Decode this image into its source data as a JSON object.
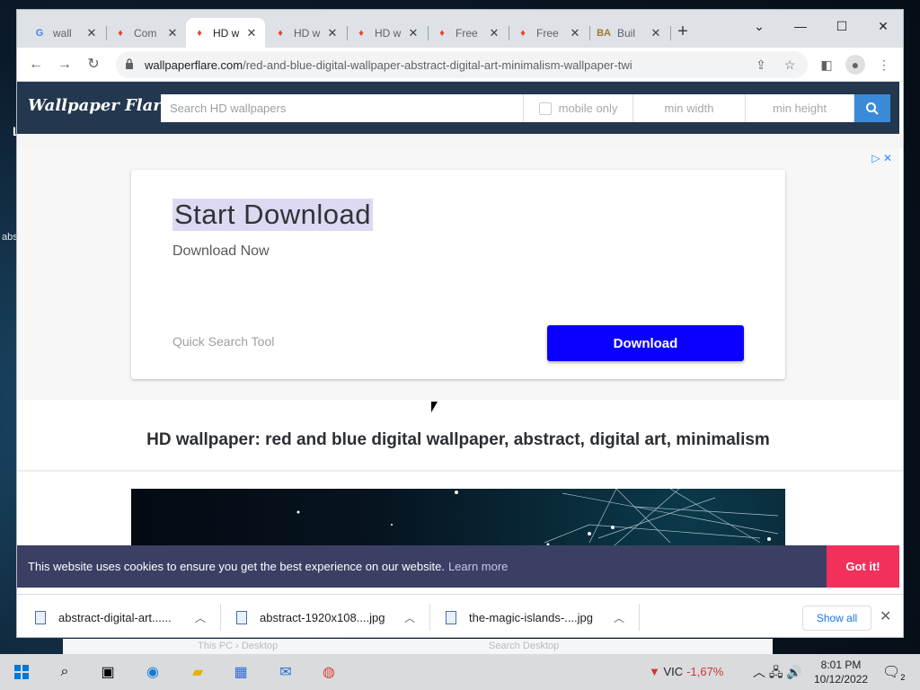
{
  "browser": {
    "tabs": [
      {
        "title": "wall",
        "favicon": "google-icon",
        "active": false
      },
      {
        "title": "Com",
        "favicon": "flame-icon",
        "active": false
      },
      {
        "title": "HD w",
        "favicon": "flame-icon",
        "active": true
      },
      {
        "title": "HD w",
        "favicon": "flame-icon",
        "active": false
      },
      {
        "title": "HD w",
        "favicon": "flame-icon",
        "active": false
      },
      {
        "title": "Free",
        "favicon": "flame-icon",
        "active": false
      },
      {
        "title": "Free",
        "favicon": "flame-icon",
        "active": false
      },
      {
        "title": "Buil",
        "favicon": "ba-icon",
        "active": false
      }
    ],
    "url_host": "wallpaperflare.com",
    "url_path": "/red-and-blue-digital-wallpaper-abstract-digital-art-minimalism-wallpaper-twi"
  },
  "site": {
    "logo": "Wallpaper Flare",
    "search_placeholder": "Search HD wallpapers",
    "mobile_only": "mobile only",
    "min_width": "min width",
    "min_height": "min height"
  },
  "ad": {
    "title": "Start Download",
    "subtitle": "Download Now",
    "tool": "Quick Search Tool",
    "button": "Download"
  },
  "page": {
    "title": "HD wallpaper: red and blue digital wallpaper, abstract, digital art, minimalism"
  },
  "cookie": {
    "text": "This website uses cookies to ensure you get the best experience on our website.",
    "link": "Learn more",
    "button": "Got it!"
  },
  "downloads": {
    "items": [
      {
        "name": "abstract-digital-art......"
      },
      {
        "name": "abstract-1920x108....jpg"
      },
      {
        "name": "the-magic-islands-....jpg"
      }
    ],
    "show_all": "Show all"
  },
  "background_window": {
    "location": "This PC › Desktop",
    "search": "Search Desktop"
  },
  "desktop": {
    "left_text": "abs"
  },
  "taskbar": {
    "weather_code": "VIC",
    "weather_value": "-1,67%",
    "time": "8:01 PM",
    "date": "10/12/2022",
    "notifications": "2"
  },
  "colors": {
    "site_header": "#23374e",
    "search_button": "#3b8ad8",
    "ad_button": "#0b00ff",
    "cookie_bar": "#3b3f64",
    "cookie_button": "#f1315c"
  }
}
